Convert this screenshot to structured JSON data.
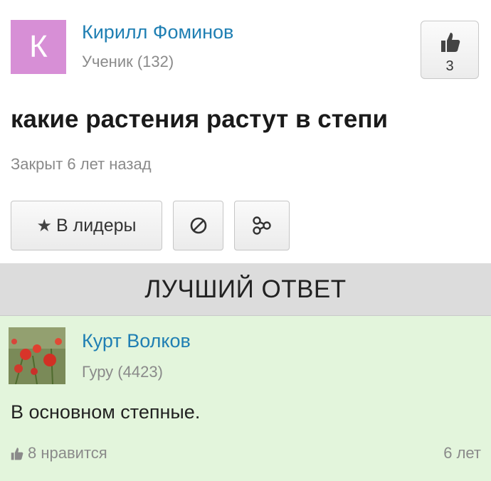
{
  "question": {
    "author": {
      "initial": "К",
      "name": "Кирилл Фоминов",
      "rank": "Ученик (132)",
      "avatar_color": "#d78fd6"
    },
    "like_count": "3",
    "title": "какие растения растут в степи",
    "status": "Закрыт 6 лет назад",
    "buttons": {
      "leaders": "В лидеры",
      "block_icon": "block-icon",
      "share_icon": "share-icon"
    }
  },
  "best_answer": {
    "header": "ЛУЧШИЙ ОТВЕТ",
    "author": {
      "name": "Курт Волков",
      "rank": "Гуру (4423)"
    },
    "text": "В основном степные.",
    "likes": "8 нравится",
    "age": "6 лет"
  },
  "colors": {
    "link": "#1f7fb3",
    "answer_bg": "#e3f5dc",
    "header_bg": "#dcdcdc"
  }
}
